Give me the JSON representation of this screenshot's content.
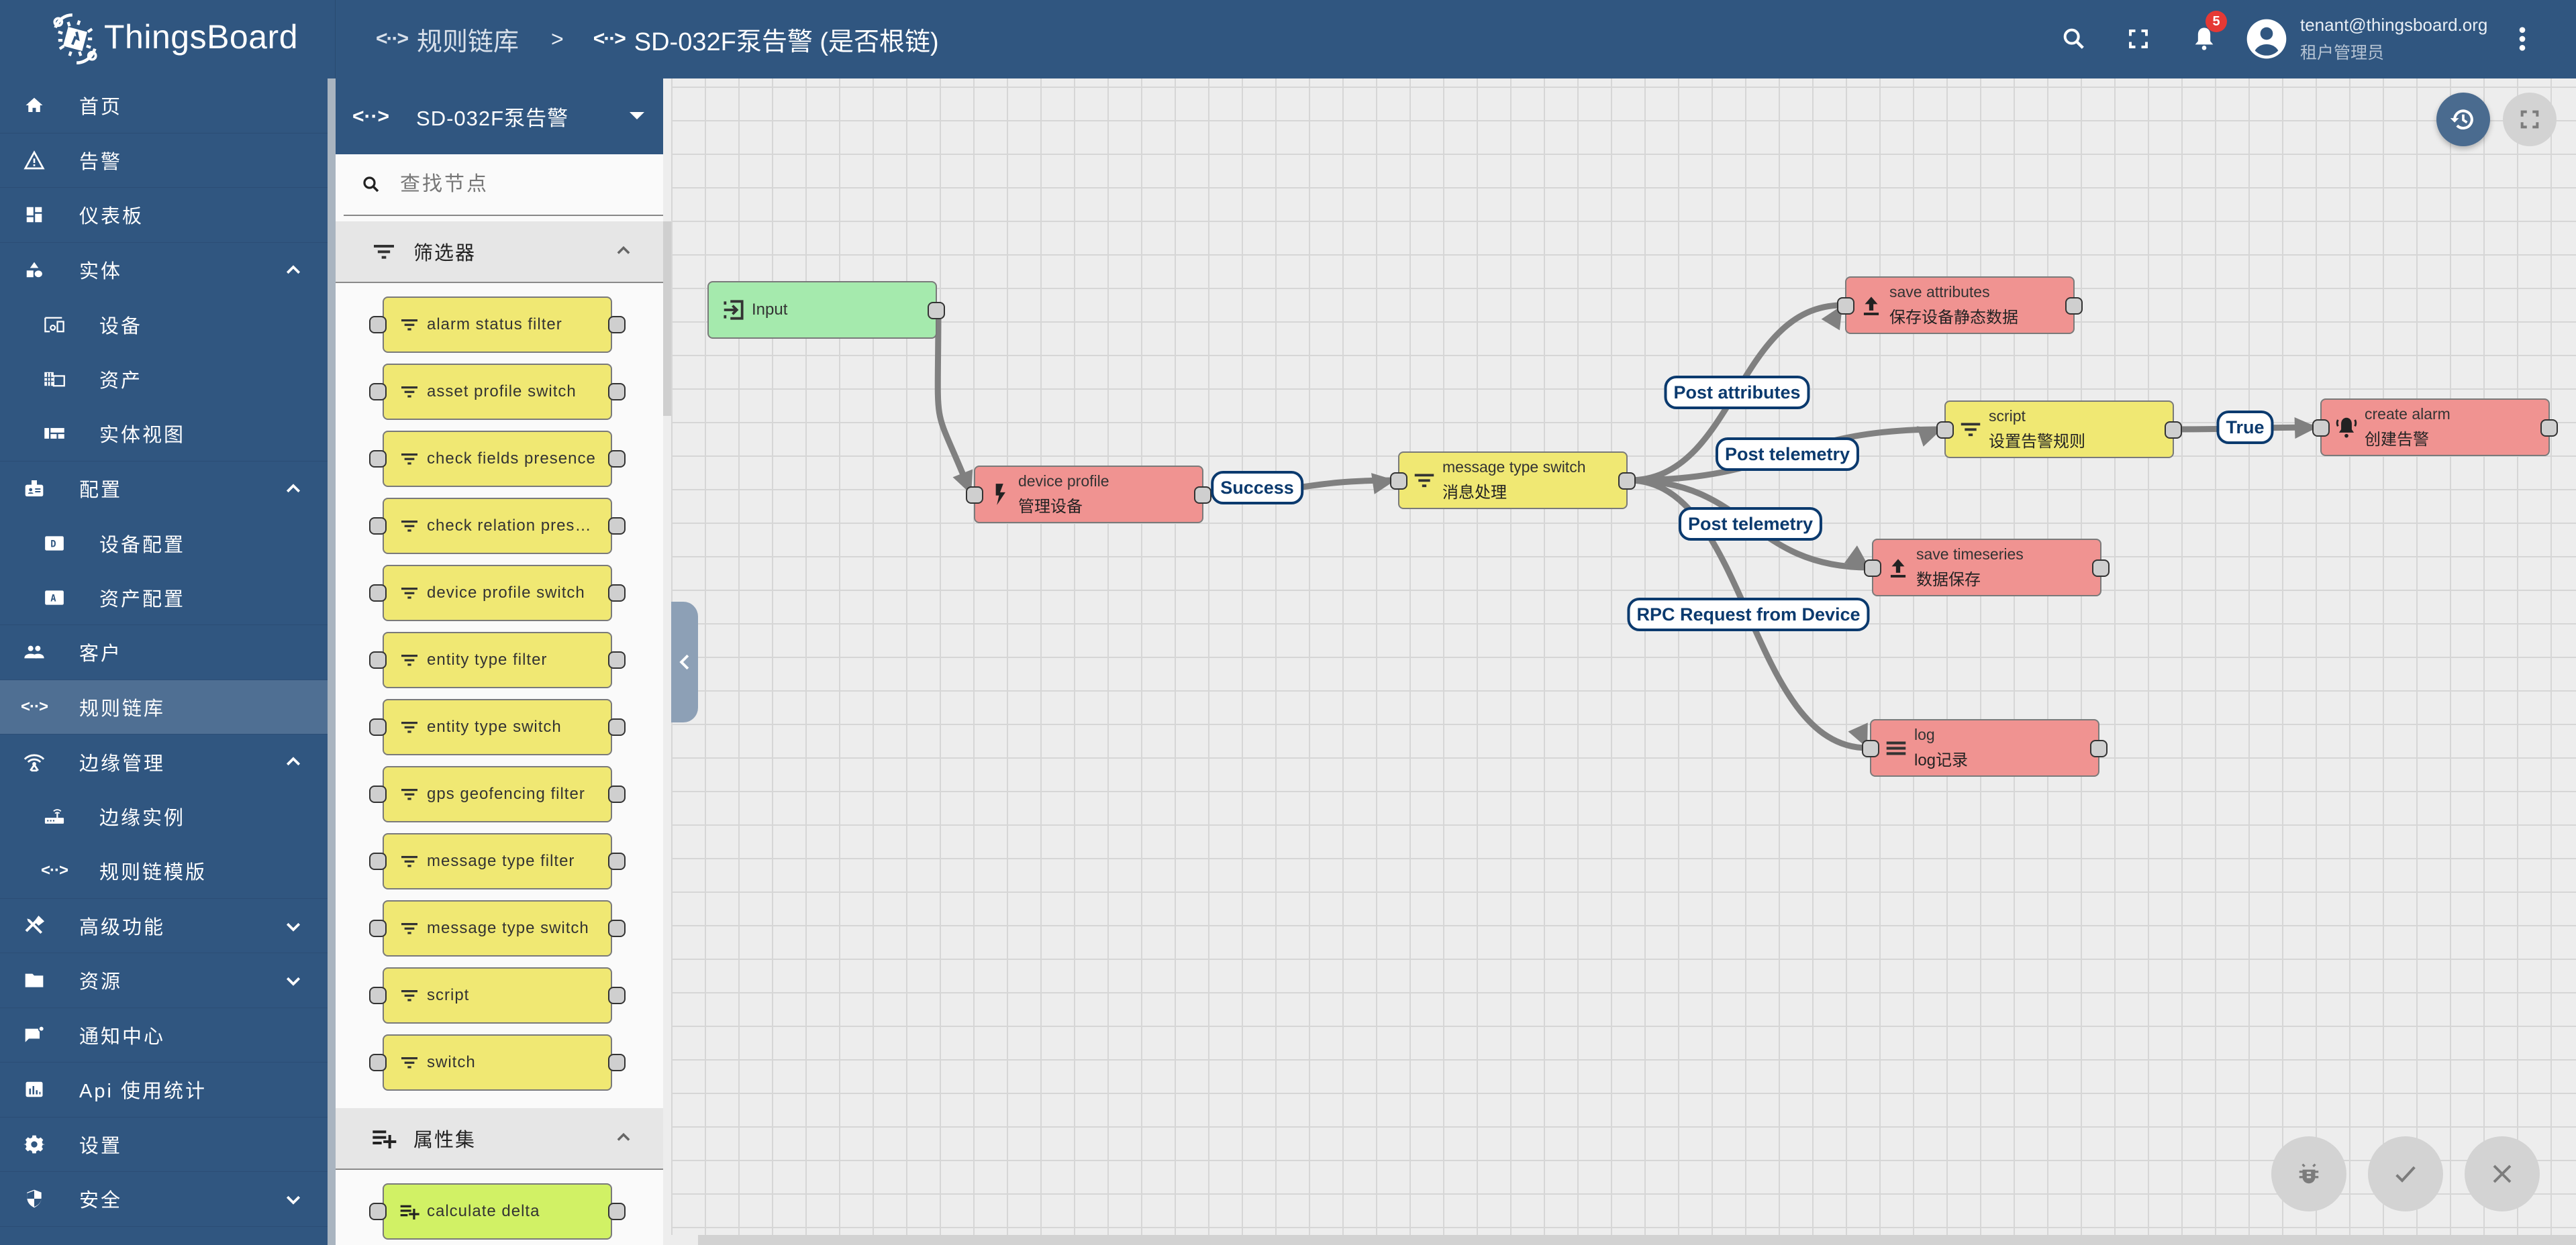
{
  "app": {
    "brand": "ThingsBoard",
    "breadcrumb": [
      {
        "label": "规则链库",
        "icon": "rule-chain-icon"
      },
      {
        "label": "SD-032F泵告警 (是否根链)",
        "icon": "rule-chain-icon"
      }
    ],
    "breadcrumb_separator": ">",
    "notifications_count": "5",
    "user": {
      "email": "tenant@thingsboard.org",
      "role": "租户管理员"
    }
  },
  "sidebar": {
    "items": [
      {
        "label": "首页",
        "icon": "home-icon"
      },
      {
        "label": "告警",
        "icon": "warning-icon"
      },
      {
        "label": "仪表板",
        "icon": "dashboard-icon"
      },
      {
        "label": "实体",
        "icon": "entities-icon",
        "expanded": true
      },
      {
        "label": "设备",
        "icon": "devices-icon",
        "sub": true
      },
      {
        "label": "资产",
        "icon": "assets-icon",
        "sub": true
      },
      {
        "label": "实体视图",
        "icon": "entity-view-icon",
        "sub": true
      },
      {
        "label": "配置",
        "icon": "profiles-icon",
        "expanded": true
      },
      {
        "label": "设备配置",
        "icon": "device-profile-icon",
        "sub": true
      },
      {
        "label": "资产配置",
        "icon": "asset-profile-icon",
        "sub": true
      },
      {
        "label": "客户",
        "icon": "customers-icon"
      },
      {
        "label": "规则链库",
        "icon": "rule-chain-icon",
        "active": true
      },
      {
        "label": "边缘管理",
        "icon": "edge-icon",
        "expanded": true
      },
      {
        "label": "边缘实例",
        "icon": "router-icon",
        "sub": true
      },
      {
        "label": "规则链模版",
        "icon": "rule-chain-icon",
        "sub": true
      },
      {
        "label": "高级功能",
        "icon": "tools-icon",
        "expanded": false
      },
      {
        "label": "资源",
        "icon": "folder-icon",
        "expanded": false
      },
      {
        "label": "通知中心",
        "icon": "notification-icon"
      },
      {
        "label": "Api 使用统计",
        "icon": "api-usage-icon"
      },
      {
        "label": "设置",
        "icon": "settings-icon"
      },
      {
        "label": "安全",
        "icon": "security-icon",
        "expanded": false
      }
    ]
  },
  "library": {
    "rule_chain_name": "SD-032F泵告警",
    "search_placeholder": "查找节点",
    "sections": [
      {
        "label": "筛选器",
        "icon": "filter-icon",
        "expanded": true,
        "nodes": [
          "alarm status filter",
          "asset profile switch",
          "check fields presence",
          "check relation presen...",
          "device profile switch",
          "entity type filter",
          "entity type switch",
          "gps geofencing filter",
          "message type filter",
          "message type switch",
          "script",
          "switch"
        ]
      },
      {
        "label": "属性集",
        "icon": "enrichment-icon",
        "expanded": true,
        "nodes": [
          "calculate delta"
        ]
      }
    ]
  },
  "chain": {
    "nodes": [
      {
        "id": "input",
        "type": "Input",
        "name": "",
        "color": "green",
        "icon": "input-icon"
      },
      {
        "id": "devprof",
        "type": "device profile",
        "name": "管理设备",
        "color": "red",
        "icon": "bolt-icon"
      },
      {
        "id": "mts",
        "type": "message type switch",
        "name": "消息处理",
        "color": "yellow",
        "icon": "filter-icon"
      },
      {
        "id": "saveattr",
        "type": "save attributes",
        "name": "保存设备静态数据",
        "color": "red",
        "icon": "upload-icon"
      },
      {
        "id": "script",
        "type": "script",
        "name": "设置告警规则",
        "color": "yellow",
        "icon": "filter-icon"
      },
      {
        "id": "alarm",
        "type": "create alarm",
        "name": "创建告警",
        "color": "red",
        "icon": "alarm-bell-icon"
      },
      {
        "id": "savets",
        "type": "save timeseries",
        "name": "数据保存",
        "color": "red",
        "icon": "upload-icon"
      },
      {
        "id": "log",
        "type": "log",
        "name": "log记录",
        "color": "red",
        "icon": "menu-icon"
      }
    ],
    "connections": [
      {
        "from": "input",
        "to": "devprof",
        "label": ""
      },
      {
        "from": "devprof",
        "to": "mts",
        "label": "Success"
      },
      {
        "from": "mts",
        "to": "saveattr",
        "label": "Post attributes"
      },
      {
        "from": "mts",
        "to": "script",
        "label": "Post telemetry"
      },
      {
        "from": "mts",
        "to": "savets",
        "label": "Post telemetry"
      },
      {
        "from": "mts",
        "to": "log",
        "label": "RPC Request from Device"
      },
      {
        "from": "script",
        "to": "alarm",
        "label": "True"
      }
    ]
  },
  "colors": {
    "primary": "#305680",
    "node_green": "#a5eaad",
    "node_red": "#f09391",
    "node_yellow": "#f0e873",
    "node_lime": "#d1f165",
    "badge": "#e53935",
    "label_border": "#0b3a6e"
  }
}
